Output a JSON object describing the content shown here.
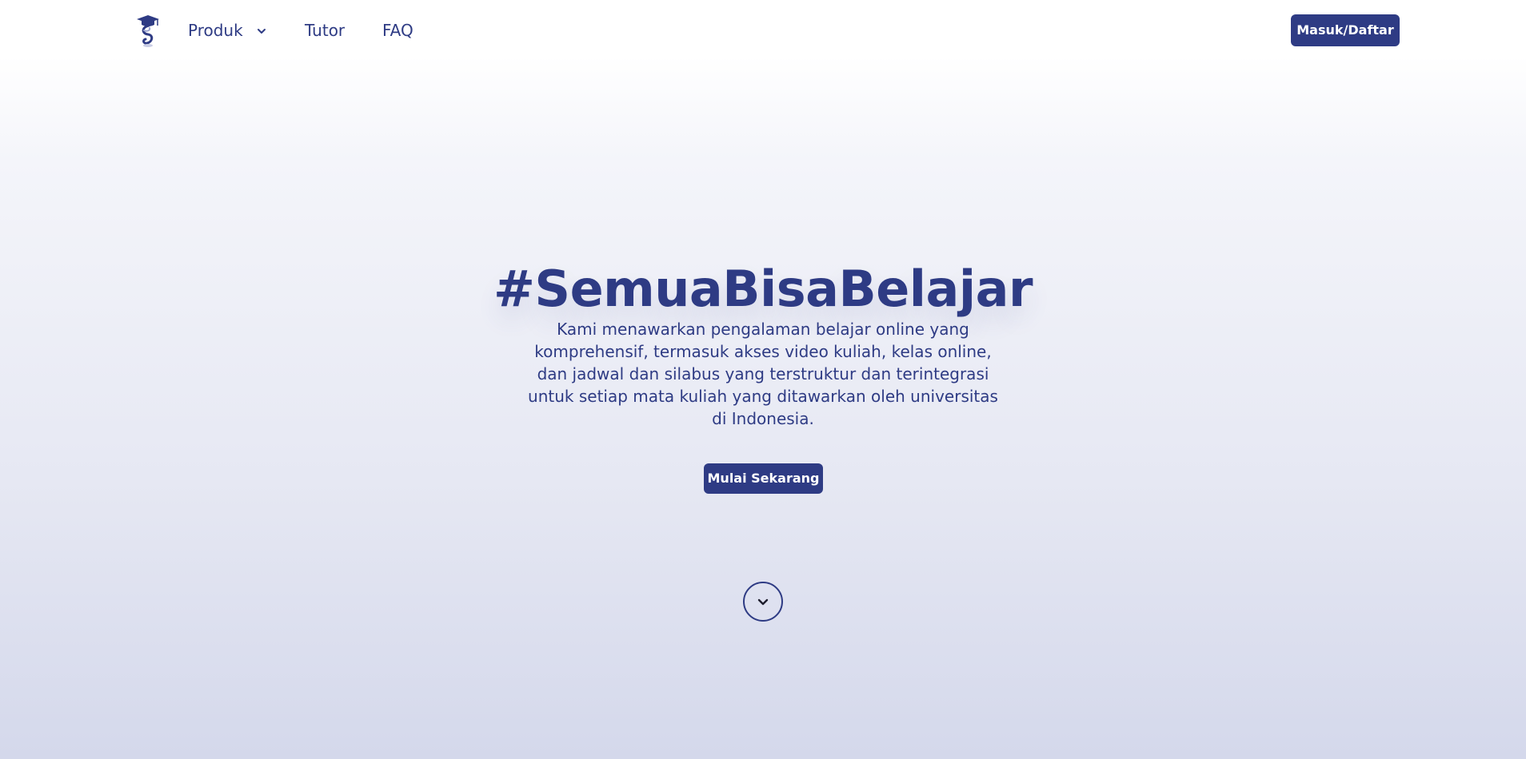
{
  "nav": {
    "logo_icon": "graduation-cap-logo-icon",
    "items": [
      {
        "label": "Produk",
        "icon": "chevron-down-icon"
      },
      {
        "label": "Tutor"
      },
      {
        "label": "FAQ"
      }
    ],
    "login_label": "Masuk/Daftar"
  },
  "hero": {
    "title": "#SemuaBisaBelajar",
    "description": "Kami menawarkan pengalaman belajar online yang komprehensif, termasuk akses video kuliah, kelas online, dan jadwal dan silabus yang terstruktur dan terintegrasi untuk setiap mata kuliah yang ditawarkan oleh universitas di Indonesia.",
    "cta_label": "Mulai Sekarang",
    "scroll_icon": "chevron-down-icon"
  },
  "colors": {
    "primary": "#2e3b84",
    "background_top": "#ffffff",
    "background_bottom": "#d4d8eb"
  }
}
